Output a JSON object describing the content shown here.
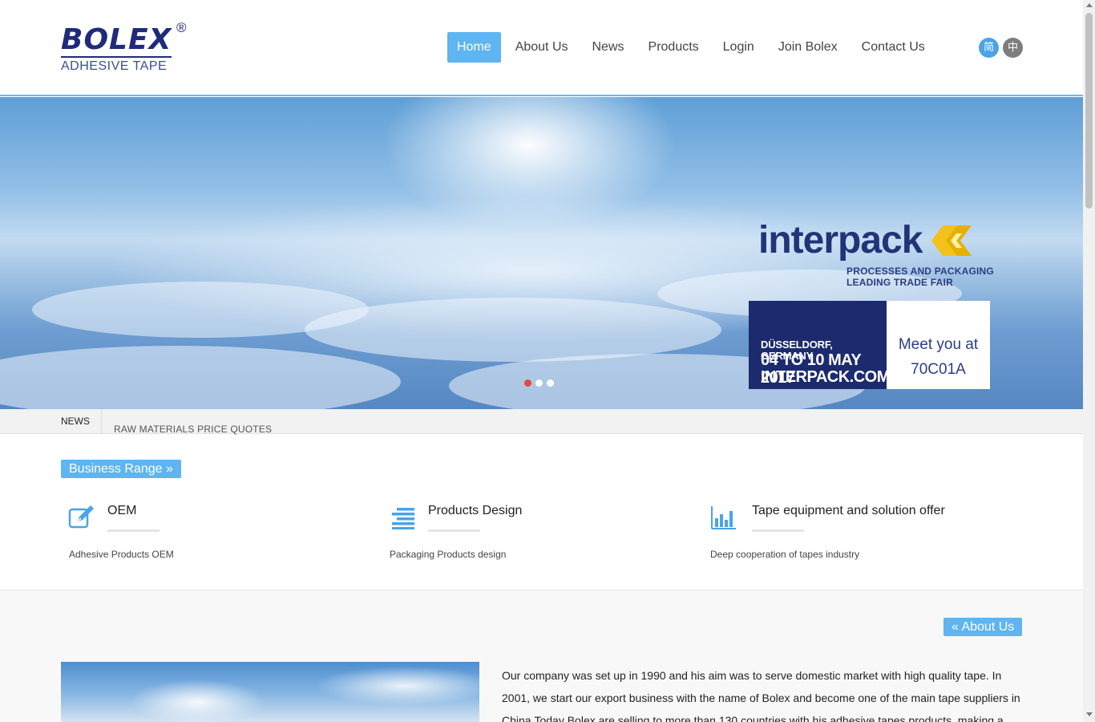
{
  "header": {
    "logo": {
      "word": "BOLEX",
      "registered": "®",
      "subtitle": "ADHESIVE TAPE"
    },
    "nav": [
      {
        "label": "Home",
        "active": true
      },
      {
        "label": "About Us",
        "active": false
      },
      {
        "label": "News",
        "active": false
      },
      {
        "label": "Products",
        "active": false
      },
      {
        "label": "Login",
        "active": false
      },
      {
        "label": "Join Bolex",
        "active": false
      },
      {
        "label": "Contact Us",
        "active": false
      }
    ],
    "lang": {
      "simplified": "简",
      "traditional": "中"
    }
  },
  "banner": {
    "brand": "interpack",
    "tagline_1": "PROCESSES AND PACKAGING",
    "tagline_2": "LEADING TRADE FAIR",
    "location": "DÜSSELDORF, GERMANY",
    "dates": "04 TO 10 MAY 2017",
    "site": "INTERPACK.COM",
    "meet": "Meet you at",
    "booth": "70C01A",
    "slides": 3,
    "active_slide": 1
  },
  "news": {
    "label": "NEWS",
    "item": "RAW MATERIALS PRICE QUOTES"
  },
  "business": {
    "tag": "Business Range »",
    "features": [
      {
        "icon": "edit-icon",
        "title": "OEM",
        "desc": "Adhesive Products OEM"
      },
      {
        "icon": "list-icon",
        "title": "Products Design",
        "desc": "Packaging Products design"
      },
      {
        "icon": "bar-chart-icon",
        "title": "Tape equipment and solution offer",
        "desc": "Deep cooperation of tapes industry"
      }
    ]
  },
  "about": {
    "tag": "« About Us",
    "text": "Our company was set up in 1990 and his aim was to serve domestic market with high quality tape. In 2001, we start our export business with the name of Bolex and become one of the main tape suppliers in China.Today Bolex are selling to more than 130 countries with his adhesive tapes products, making a"
  },
  "colors": {
    "accent": "#5eb5f2",
    "logo_navy": "#1f2b7a",
    "active_dot": "#e24b3b"
  }
}
